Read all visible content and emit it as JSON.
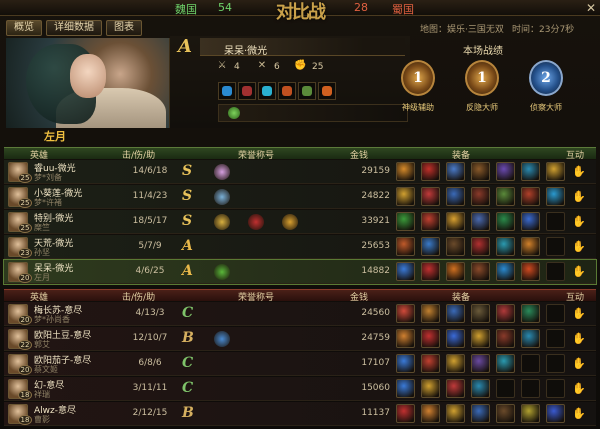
{
  "top": {
    "wei_label": "魏国",
    "wei_score": "54",
    "shu_score": "28",
    "shu_label": "蜀国",
    "logo": "对比战",
    "close": "✕"
  },
  "tabs": [
    "概览",
    "详细数据",
    "图表"
  ],
  "map_info": "地图：娱乐·三国无双",
  "time_info": "时间：23分7秒",
  "hero_name": "左月",
  "player": {
    "grade": "A",
    "name": "呆呆·微光",
    "stats": [
      "4",
      "6",
      "25"
    ]
  },
  "record": {
    "title": "本场战绩",
    "badges": [
      {
        "label": "神级辅助",
        "glyph": "1",
        "style": "gold"
      },
      {
        "label": "反隐大师",
        "glyph": "1",
        "style": "gold"
      },
      {
        "label": "侦察大师",
        "glyph": "2",
        "style": "blue"
      }
    ]
  },
  "headers": {
    "hero": "英雄",
    "kda": "击/伤/助",
    "honor": "荣誉称号",
    "gold": "金钱",
    "equip": "装备",
    "interact": "互动"
  },
  "wei_rows": [
    {
      "name": "睿uu-微光",
      "hero": "梦*刘备",
      "level": "25",
      "kda": "14/6/18",
      "grade": "S",
      "honors": [
        "#d7a0e0"
      ],
      "gold": "29159",
      "items": [
        "#d58a2a",
        "#c0302a",
        "#4a7ac8",
        "#8a5a2a",
        "#6a4ab0",
        "#2a8ab0",
        "#d0a030"
      ],
      "me": false
    },
    {
      "name": "小葵莲-微光",
      "hero": "梦*许褚",
      "level": "25",
      "kda": "11/4/23",
      "grade": "S",
      "honors": [
        "#7ab0d8"
      ],
      "gold": "24822",
      "items": [
        "#d0a030",
        "#c03a3a",
        "#3a6ab8",
        "#8a3a2a",
        "#5a8a3a",
        "#b0402a",
        "#2a9ad0"
      ],
      "me": false
    },
    {
      "name": "特别-微光",
      "hero": "糜竺",
      "level": "25",
      "kda": "18/5/17",
      "grade": "S",
      "honors": [
        "#d8b040",
        "#c03030",
        "#d8a030"
      ],
      "gold": "33921",
      "items": [
        "#3a9a3a",
        "#c04030",
        "#d8a030",
        "#4a6ab0",
        "#2a8a4a",
        "#3a6ad0",
        ""
      ],
      "me": false
    },
    {
      "name": "天荒-微光",
      "hero": "孙坚",
      "level": "23",
      "kda": "5/7/9",
      "grade": "A",
      "honors": [],
      "gold": "25653",
      "items": [
        "#c05a2a",
        "#3a7ac8",
        "#6a4a2a",
        "#b03030",
        "#2a9ab0",
        "#d0802a",
        ""
      ],
      "me": false
    },
    {
      "name": "呆呆-微光",
      "hero": "左月",
      "level": "20",
      "kda": "4/6/25",
      "grade": "A",
      "honors": [
        "#5ab83a"
      ],
      "gold": "14882",
      "items": [
        "#3a7ad8",
        "#c03030",
        "#d07020",
        "#8a4a2a",
        "#2a8ad0",
        "#d04a20",
        ""
      ],
      "me": true
    }
  ],
  "shu_rows": [
    {
      "name": "梅长苏-意尽",
      "hero": "梦*孙尚香",
      "level": "20",
      "kda": "4/13/3",
      "grade": "C",
      "honors": [],
      "gold": "24560",
      "items": [
        "#d04a3a",
        "#c08030",
        "#3a6ab8",
        "#6a5a3a",
        "#b03a3a",
        "#2a8a5a",
        ""
      ],
      "me": false
    },
    {
      "name": "欧阳土豆-意尽",
      "hero": "郭艾",
      "level": "22",
      "kda": "12/10/7",
      "grade": "B",
      "honors": [
        "#4a8ad0"
      ],
      "gold": "24759",
      "items": [
        "#d08030",
        "#c03030",
        "#3a6ad8",
        "#d0a030",
        "#8a3a2a",
        "#2a8ab0",
        ""
      ],
      "me": false
    },
    {
      "name": "欧阳茄子-意尽",
      "hero": "蔡文姬",
      "level": "20",
      "kda": "6/8/6",
      "grade": "C",
      "honors": [],
      "gold": "17107",
      "items": [
        "#3a7ad8",
        "#c04030",
        "#d0a030",
        "#6a4aa0",
        "#2a9ab0",
        "",
        ""
      ],
      "me": false
    },
    {
      "name": "幻-意尽",
      "hero": "祥瑞",
      "level": "18",
      "kda": "3/11/11",
      "grade": "C",
      "honors": [],
      "gold": "15060",
      "items": [
        "#3a7ad8",
        "#d0a030",
        "#c03a3a",
        "#2a8ab0",
        "",
        "",
        ""
      ],
      "me": false
    },
    {
      "name": "Alwz-意尽",
      "hero": "曹影",
      "level": "18",
      "kda": "2/12/15",
      "grade": "B",
      "honors": [],
      "gold": "11137",
      "items": [
        "#c03030",
        "#d08030",
        "#d0a030",
        "#3a6ab8",
        "#6a4a2a",
        "#b0a030",
        "#3a5ad0"
      ],
      "me": false
    }
  ]
}
